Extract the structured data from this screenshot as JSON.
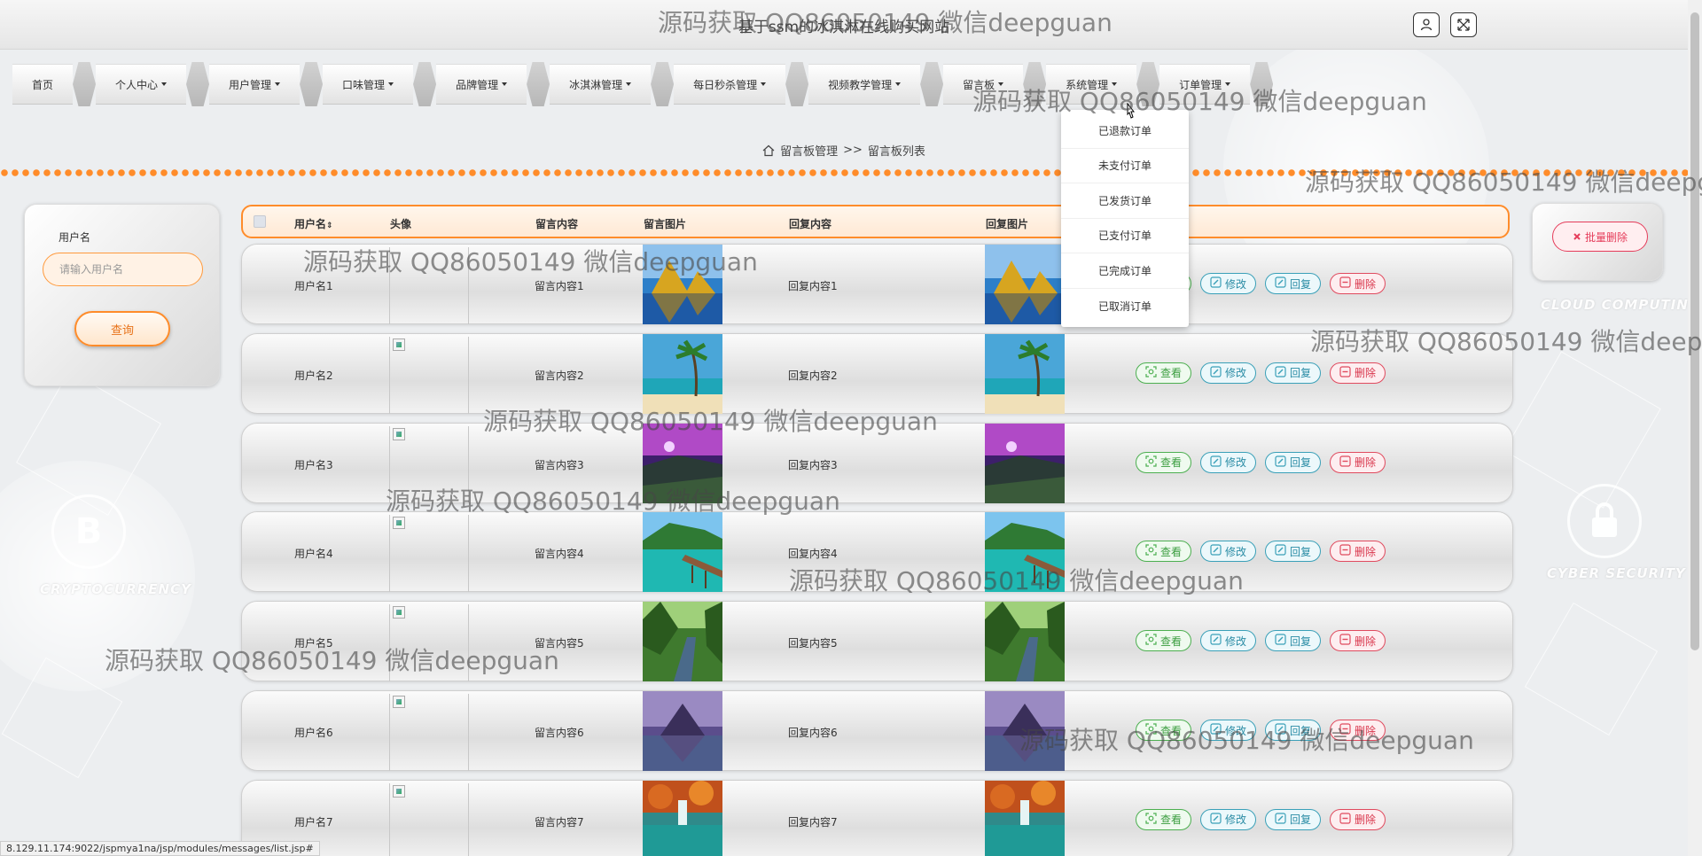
{
  "header": {
    "site_title": "基于ssm的冰淇淋在线购买网站",
    "icons": [
      "user-icon",
      "fullscreen-icon"
    ]
  },
  "nav": {
    "items": [
      {
        "label": "首页",
        "dropdown": false
      },
      {
        "label": "个人中心",
        "dropdown": true
      },
      {
        "label": "用户管理",
        "dropdown": true
      },
      {
        "label": "口味管理",
        "dropdown": true
      },
      {
        "label": "品牌管理",
        "dropdown": true
      },
      {
        "label": "冰淇淋管理",
        "dropdown": true
      },
      {
        "label": "每日秒杀管理",
        "dropdown": true
      },
      {
        "label": "视频教学管理",
        "dropdown": true
      },
      {
        "label": "留言板",
        "dropdown": true
      },
      {
        "label": "系统管理",
        "dropdown": true
      },
      {
        "label": "订单管理",
        "dropdown": true
      }
    ],
    "open_dropdown": [
      "已退款订单",
      "未支付订单",
      "已发货订单",
      "已支付订单",
      "已完成订单",
      "已取消订单"
    ]
  },
  "breadcrumb": {
    "section": "留言板管理",
    "separator": ">>",
    "page": "留言板列表"
  },
  "search": {
    "label": "用户名",
    "placeholder": "请输入用户名",
    "button": "查询"
  },
  "batch_delete": {
    "label": "批量删除"
  },
  "table": {
    "headers": {
      "username": "用户名",
      "avatar": "头像",
      "content": "留言内容",
      "image": "留言图片",
      "reply": "回复内容",
      "reply_image": "回复图片"
    },
    "rows": [
      {
        "username": "用户名1",
        "content": "留言内容1",
        "reply": "回复内容1",
        "image": "mountain-lake"
      },
      {
        "username": "用户名2",
        "content": "留言内容2",
        "reply": "回复内容2",
        "image": "palm-beach"
      },
      {
        "username": "用户名3",
        "content": "留言内容3",
        "reply": "回复内容3",
        "image": "purple-coast"
      },
      {
        "username": "用户名4",
        "content": "留言内容4",
        "reply": "回复内容4",
        "image": "tropical-pier"
      },
      {
        "username": "用户名5",
        "content": "留言内容5",
        "reply": "回复内容5",
        "image": "forest-river"
      },
      {
        "username": "用户名6",
        "content": "留言内容6",
        "reply": "回复内容6",
        "image": "misty-mountain"
      },
      {
        "username": "用户名7",
        "content": "留言内容7",
        "reply": "回复内容7",
        "image": "autumn-waterfall"
      }
    ],
    "actions": {
      "view": "查看",
      "edit": "修改",
      "reply": "回复",
      "delete": "删除"
    }
  },
  "background_labels": {
    "cloud": "CLOUD COMPUTING",
    "crypto": "CRYPTOCURRENCY",
    "security": "CYBER SECURITY"
  },
  "watermark": "源码获取 QQ86050149 微信deepguan",
  "statusbar": {
    "url": "8.129.11.174:9022/jspmya1na/jsp/modules/messages/list.jsp#"
  },
  "colors": {
    "accent": "#ff8c2a",
    "view": "#4caf50",
    "edit": "#3aa0b8",
    "delete": "#e04a5e"
  }
}
